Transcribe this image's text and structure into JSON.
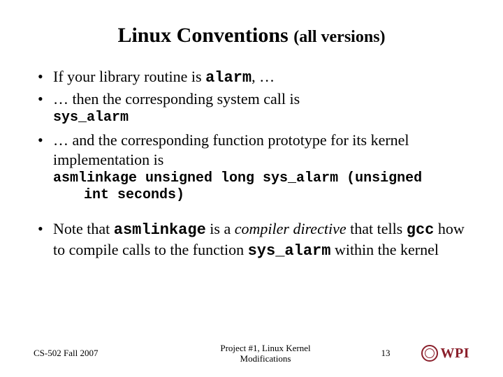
{
  "title_main": "Linux Conventions ",
  "title_sub": "(all versions)",
  "bullets": {
    "b1_pre": "If your library routine is ",
    "b1_code": "alarm",
    "b1_post": ", …",
    "b2": "… then the corresponding system call is",
    "b2_sub": "sys_alarm",
    "b3": "… and the corresponding function prototype for its kernel implementation is",
    "b3_sub_l1": "asmlinkage unsigned long sys_alarm (unsigned",
    "b3_sub_l2": "int seconds)",
    "b4_pre": "Note that ",
    "b4_code1": "asmlinkage",
    "b4_mid1": " is a ",
    "b4_ital": "compiler directive",
    "b4_mid2": " that tells ",
    "b4_code2": "gcc",
    "b4_mid3": " how to compile calls to the function ",
    "b4_code3": "sys_alarm",
    "b4_post": " within the kernel"
  },
  "footer": {
    "left": "CS-502 Fall 2007",
    "center_l1": "Project #1, Linux Kernel",
    "center_l2": "Modifications",
    "pagenum": "13",
    "logo_text": "WPI"
  }
}
